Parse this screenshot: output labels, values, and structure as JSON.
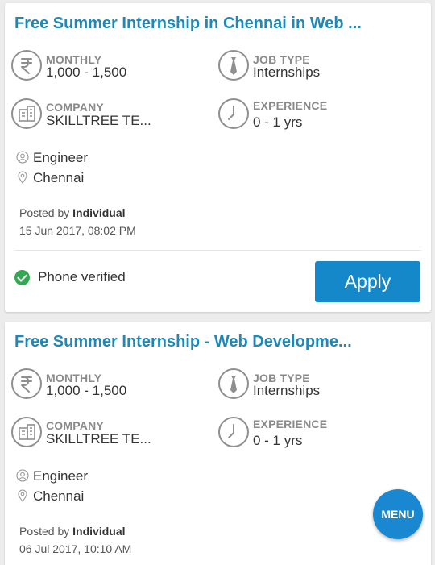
{
  "listings": [
    {
      "title": "Free Summer Internship in Chennai in Web ...",
      "salary_label": "MONTHLY",
      "salary_value": "1,000 - 1,500",
      "jobtype_label": "JOB TYPE",
      "jobtype_value": "Internships",
      "company_label": "COMPANY",
      "company_value": "SKILLTREE TE...",
      "experience_label": "EXPERIENCE",
      "experience_value": "0 - 1 yrs",
      "role": "Engineer",
      "location": "Chennai",
      "posted_prefix": "Posted by ",
      "posted_by": "Individual",
      "posted_date": "15 Jun 2017, 08:02 PM",
      "verified_text": "Phone verified",
      "apply_label": "Apply"
    },
    {
      "title": "Free Summer Internship - Web Developme...",
      "salary_label": "MONTHLY",
      "salary_value": "1,000 - 1,500",
      "jobtype_label": "JOB TYPE",
      "jobtype_value": "Internships",
      "company_label": "COMPANY",
      "company_value": "SKILLTREE TE...",
      "experience_label": "EXPERIENCE",
      "experience_value": "0 - 1 yrs",
      "role": "Engineer",
      "location": "Chennai",
      "posted_prefix": "Posted by ",
      "posted_by": "Individual",
      "posted_date": "06 Jul 2017, 10:10 AM"
    }
  ],
  "fab": {
    "label": "MENU"
  },
  "icons": [
    "rupee-icon",
    "tie-icon",
    "building-icon",
    "clock-icon",
    "person-icon",
    "location-pin-icon",
    "check-circle-icon"
  ],
  "colors": {
    "title": "#1d89b8",
    "apply": "#1488c9",
    "verified": "#35a853",
    "fab": "#1a88d0"
  }
}
